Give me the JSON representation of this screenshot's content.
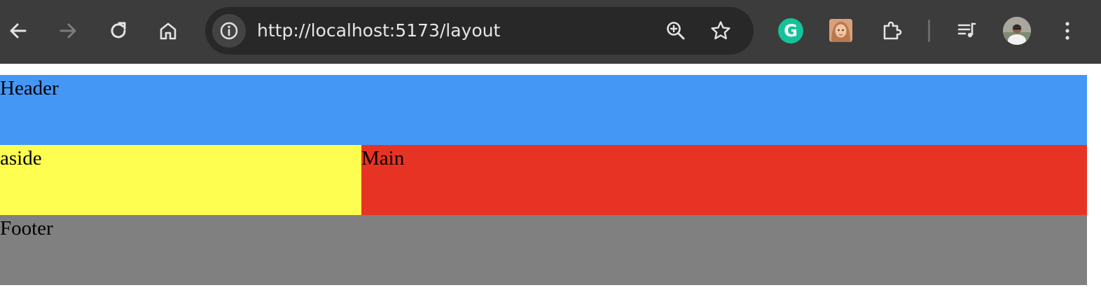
{
  "browser": {
    "url": "http://localhost:5173/layout",
    "colors": {
      "toolbar": "#3c3c3c",
      "omnibox": "#282828",
      "icon": "#e3e3e3",
      "icon_disabled": "#7d7d7d"
    },
    "nav_icons": [
      "back-icon",
      "forward-icon",
      "reload-icon",
      "home-icon"
    ],
    "omnibox_icons": [
      "site-info-icon",
      "zoom-icon",
      "bookmark-star-icon"
    ],
    "extension_icons": [
      "grammarly-icon",
      "avatar-extension-icon",
      "extensions-puzzle-icon"
    ],
    "right_icons": [
      "media-controls-icon",
      "profile-avatar",
      "more-menu-icon"
    ],
    "grammarly_letter": "G"
  },
  "layout": {
    "header": "Header",
    "aside": "aside",
    "main": "Main",
    "footer": "Footer",
    "colors": {
      "header": "#4597f6",
      "aside": "#fefe50",
      "main": "#e73323",
      "footer": "#808080"
    }
  }
}
